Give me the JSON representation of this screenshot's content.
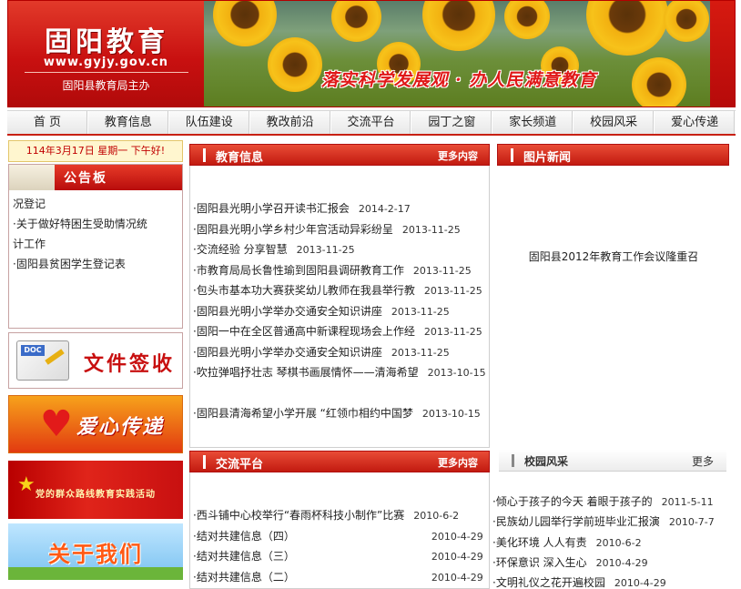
{
  "header": {
    "logo_title": "固阳教育",
    "logo_url": "www.gyjy.gov.cn",
    "logo_sub": "固阳县教育局主办",
    "slogan": "落实科学发展观 · 办人民满意教育"
  },
  "nav": [
    "首 页",
    "教育信息",
    "队伍建设",
    "教改前沿",
    "交流平台",
    "园丁之窗",
    "家长频道",
    "校园风采",
    "爱心传递"
  ],
  "left": {
    "date_text": "114年3月17日 星期一 下午好!",
    "notice_title": "公告板",
    "notice_lines": [
      "况登记",
      "·关于做好特困生受助情况统",
      "计工作",
      "·固阳县贫困学生登记表"
    ],
    "doc_tag": "DOC",
    "doc_label": "文件签收",
    "love_label": "爱心传递",
    "party_label": "党的群众路线教育实践活动",
    "about_label": "关于我们"
  },
  "edu_info": {
    "title": "教育信息",
    "more": "更多内容",
    "items": [
      {
        "text": "·固阳县光明小学召开读书汇报会",
        "date": "2014-2-17"
      },
      {
        "text": "·固阳县光明小学乡村少年宫活动异彩纷呈",
        "date": "2013-11-25"
      },
      {
        "text": "·交流经验  分享智慧",
        "date": "2013-11-25"
      },
      {
        "text": "·市教育局局长鲁性瑜到固阳县调研教育工作",
        "date": "2013-11-25"
      },
      {
        "text": "·包头市基本功大赛获奖幼儿教师在我县举行教",
        "date": "2013-11-25"
      },
      {
        "text": "·固阳县光明小学举办交通安全知识讲座",
        "date": "2013-11-25"
      },
      {
        "text": "·固阳一中在全区普通高中新课程现场会上作经",
        "date": "2013-11-25"
      },
      {
        "text": "·固阳县光明小学举办交通安全知识讲座",
        "date": "2013-11-25"
      },
      {
        "text": "·吹拉弹唱抒壮志 琴棋书画展情怀——清海希望",
        "date": "2013-10-15"
      },
      {
        "text": "·固阳县清海希望小学开展 “红领巾相约中国梦",
        "date": "2013-10-15"
      }
    ]
  },
  "exchange": {
    "title": "交流平台",
    "more": "更多内容",
    "items": [
      {
        "text": "·西斗铺中心校举行“春雨杯科技小制作”比赛",
        "date": "2010-6-2"
      },
      {
        "text": "·结对共建信息（四）",
        "date": "2010-4-29"
      },
      {
        "text": "·结对共建信息（三）",
        "date": "2010-4-29"
      },
      {
        "text": "·结对共建信息（二）",
        "date": "2010-4-29"
      }
    ]
  },
  "pic_news": {
    "title": "图片新闻",
    "caption": "固阳县2012年教育工作会议隆重召"
  },
  "campus": {
    "title": "校园风采",
    "more": "更多",
    "items": [
      {
        "text": "·倾心于孩子的今天  着眼于孩子的",
        "date": "2011-5-11"
      },
      {
        "text": "·民族幼儿园举行学前班毕业汇报演",
        "date": "2010-7-7"
      },
      {
        "text": "·美化环境    人人有责",
        "date": "2010-6-2"
      },
      {
        "text": "·环保意识    深入生心",
        "date": "2010-4-29"
      },
      {
        "text": "·文明礼仪之花开遍校园",
        "date": "2010-4-29"
      }
    ]
  },
  "colors": {
    "brand_red": "#c81010",
    "nav_bg": "#f3f3f3"
  }
}
